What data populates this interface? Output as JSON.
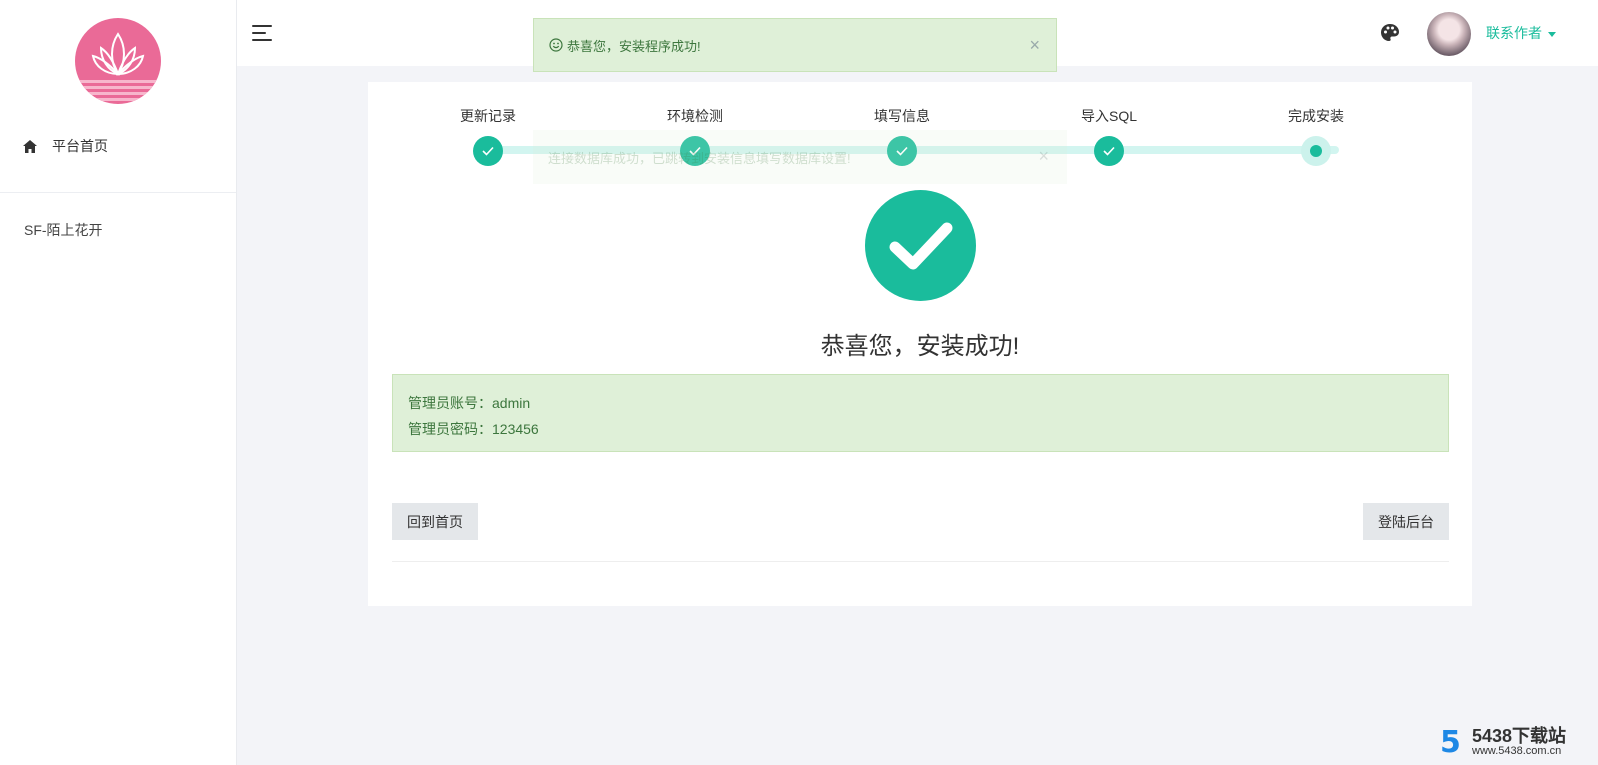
{
  "sidebar": {
    "nav": [
      {
        "label": "平台首页",
        "icon": "home-icon"
      }
    ],
    "footer_text": "SF-陌上花开"
  },
  "header": {
    "menu_icon": "hamburger-icon",
    "theme_icon": "palette-icon",
    "contact_label": "联系作者"
  },
  "toast": {
    "message": "恭喜您，安装程序成功!",
    "close": "×",
    "ghost_message": "连接数据库成功，已跳转到安装信息填写数据库设置!"
  },
  "steps": [
    {
      "label": "更新记录",
      "state": "done"
    },
    {
      "label": "环境检测",
      "state": "done"
    },
    {
      "label": "填写信息",
      "state": "done"
    },
    {
      "label": "导入SQL",
      "state": "done"
    },
    {
      "label": "完成安装",
      "state": "current"
    }
  ],
  "result": {
    "title": "恭喜您，安装成功!",
    "account_line": "管理员账号：admin",
    "password_line": "管理员密码：123456"
  },
  "buttons": {
    "home": "回到首页",
    "admin": "登陆后台"
  },
  "watermark": {
    "logo": "5",
    "title": "5438下载站",
    "url": "www.5438.com.cn"
  },
  "colors": {
    "accent": "#1abc9c",
    "logo_bg": "#ea6a97",
    "success_bg": "#dff0d8",
    "success_text": "#3c763d"
  }
}
